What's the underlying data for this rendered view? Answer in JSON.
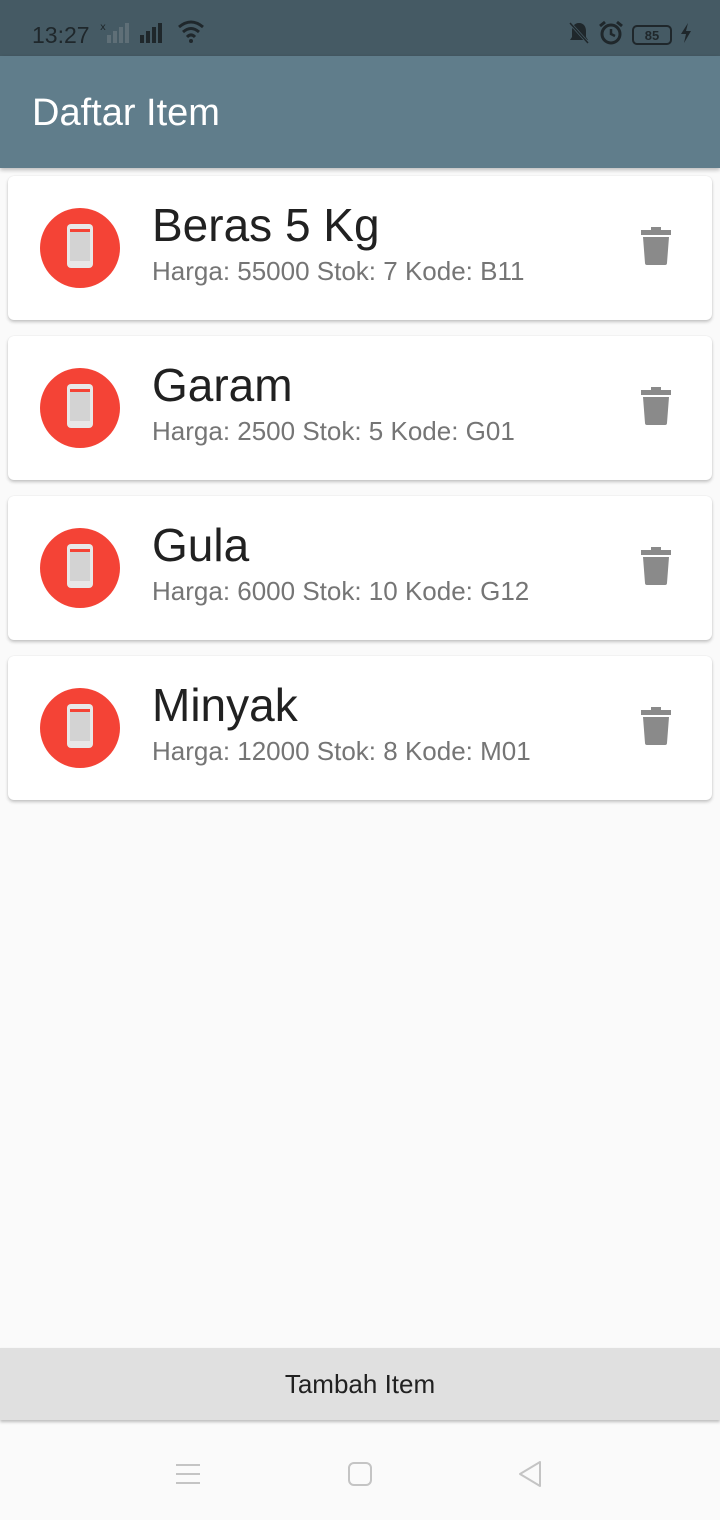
{
  "status_bar": {
    "time": "13:27",
    "battery": "85",
    "icons": [
      "signal-x-icon",
      "signal-icon",
      "wifi-icon",
      "mute-icon",
      "alarm-icon",
      "battery-icon",
      "charging-icon"
    ]
  },
  "app_bar": {
    "title": "Daftar Item",
    "color": "#607d8b"
  },
  "items": [
    {
      "title": "Beras 5 Kg",
      "subtitle": "Harga: 55000 Stok: 7 Kode: B11",
      "icon": "phone-icon",
      "action_icon": "trash-icon"
    },
    {
      "title": "Garam",
      "subtitle": "Harga: 2500 Stok: 5 Kode: G01",
      "icon": "phone-icon",
      "action_icon": "trash-icon"
    },
    {
      "title": "Gula",
      "subtitle": "Harga: 6000 Stok: 10 Kode: G12",
      "icon": "phone-icon",
      "action_icon": "trash-icon"
    },
    {
      "title": "Minyak",
      "subtitle": "Harga: 12000 Stok: 8 Kode: M01",
      "icon": "phone-icon",
      "action_icon": "trash-icon"
    }
  ],
  "add_button": {
    "label": "Tambah Item"
  },
  "colors": {
    "avatar": "#f44336",
    "status_bar": "#455a64",
    "background": "#fafafa"
  },
  "nav_bar": {
    "icons": [
      "menu-icon",
      "home-icon",
      "back-icon"
    ]
  }
}
